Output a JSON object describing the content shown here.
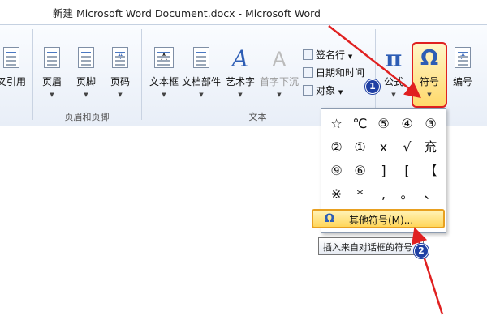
{
  "window": {
    "title": "新建 Microsoft Word Document.docx  -  Microsoft Word"
  },
  "ribbon": {
    "cross_ref_partial": "叉引用",
    "header_footer_group": {
      "label": "页眉和页脚",
      "buttons": [
        {
          "label": "页眉"
        },
        {
          "label": "页脚"
        },
        {
          "label": "页码"
        }
      ]
    },
    "text_group": {
      "label": "文本",
      "buttons": [
        {
          "label": "文本框"
        },
        {
          "label": "文档部件"
        },
        {
          "label": "艺术字"
        },
        {
          "label": "首字下沉"
        }
      ],
      "small_items": [
        {
          "label": "签名行"
        },
        {
          "label": "日期和时间"
        },
        {
          "label": "对象"
        }
      ]
    },
    "symbols_group": {
      "formula": {
        "label": "公式"
      },
      "symbol": {
        "label": "符号"
      },
      "numbering": {
        "label": "编号"
      }
    }
  },
  "symbol_dropdown": {
    "symbols": [
      "☆",
      "℃",
      "⑤",
      "④",
      "③",
      "②",
      "①",
      "x",
      "√",
      "㐬",
      "⑨",
      "⑥",
      "]",
      "[",
      "【",
      "※",
      "*",
      ",",
      "。",
      "、"
    ],
    "more_symbols_label": "其他符号(M)..."
  },
  "tooltip": {
    "text": "插入来自对话框的符号"
  },
  "annotations": {
    "badge1": "1",
    "badge2": "2"
  },
  "colors": {
    "highlight": "#ffd65a",
    "annotation_red": "#e02020",
    "badge_blue": "#1f3fa3"
  }
}
